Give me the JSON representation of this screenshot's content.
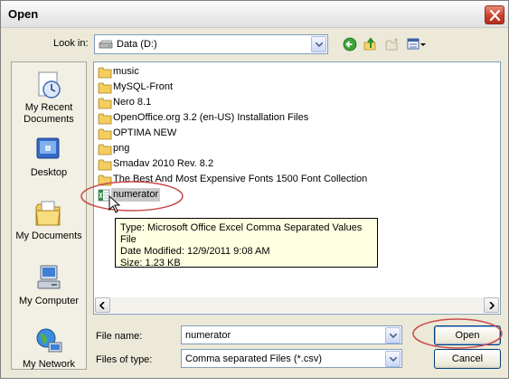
{
  "window": {
    "title": "Open"
  },
  "lookin": {
    "label": "Look in:",
    "value": "Data (D:)"
  },
  "toolbar": {
    "icons": [
      "back-icon",
      "up-folder-icon",
      "new-folder-icon",
      "views-menu-icon"
    ]
  },
  "places": [
    {
      "label": "My Recent Documents",
      "icon": "recent-documents-icon"
    },
    {
      "label": "Desktop",
      "icon": "desktop-icon"
    },
    {
      "label": "My Documents",
      "icon": "my-documents-icon"
    },
    {
      "label": "My Computer",
      "icon": "my-computer-icon"
    },
    {
      "label": "My Network",
      "icon": "my-network-icon"
    }
  ],
  "files": [
    {
      "name": "music",
      "type": "folder"
    },
    {
      "name": "MySQL-Front",
      "type": "folder"
    },
    {
      "name": "Nero 8.1",
      "type": "folder"
    },
    {
      "name": "OpenOffice.org 3.2 (en-US) Installation Files",
      "type": "folder"
    },
    {
      "name": "OPTIMA NEW",
      "type": "folder"
    },
    {
      "name": "png",
      "type": "folder"
    },
    {
      "name": "Smadav 2010 Rev. 8.2",
      "type": "folder"
    },
    {
      "name": "The Best And Most Expensive Fonts 1500 Font Collection",
      "type": "folder"
    },
    {
      "name": "numerator",
      "type": "csv",
      "selected": true
    }
  ],
  "tooltip": {
    "line1": "Type: Microsoft Office Excel Comma Separated Values File",
    "line2": "Date Modified: 12/9/2011 9:08 AM",
    "line3": "Size: 1.23 KB"
  },
  "filename": {
    "label": "File name:",
    "value": "numerator"
  },
  "filetype": {
    "label": "Files of type:",
    "value": "Comma separated Files (*.csv)"
  },
  "buttons": {
    "open": "Open",
    "cancel": "Cancel"
  },
  "colors": {
    "highlight_ellipse": "#c94a4a",
    "tooltip_bg": "#ffffe1",
    "selection": "#c9c9c9"
  }
}
